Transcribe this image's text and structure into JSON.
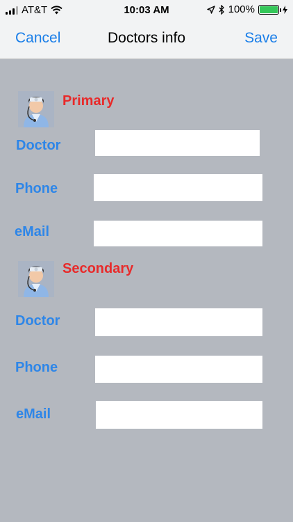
{
  "status_bar": {
    "carrier": "AT&T",
    "time": "10:03 AM",
    "battery": "100%",
    "icons": [
      "signal-icon",
      "wifi-icon",
      "location-arrow-icon",
      "bluetooth-icon",
      "battery-icon",
      "charging-bolt-icon"
    ],
    "battery_color": "#34c759"
  },
  "nav": {
    "cancel_label": "Cancel",
    "title": "Doctors info",
    "save_label": "Save",
    "accent_color": "#1a7ee8"
  },
  "sections": [
    {
      "title": "Primary",
      "icon": "doctor-icon",
      "fields": [
        {
          "label": "Doctor",
          "value": ""
        },
        {
          "label": "Phone",
          "value": ""
        },
        {
          "label": "eMail",
          "value": ""
        }
      ]
    },
    {
      "title": "Secondary",
      "icon": "doctor-icon",
      "fields": [
        {
          "label": "Doctor",
          "value": ""
        },
        {
          "label": "Phone",
          "value": ""
        },
        {
          "label": "eMail",
          "value": ""
        }
      ]
    }
  ],
  "colors": {
    "background": "#b4b8bf",
    "section_title": "#e82a2a",
    "field_label": "#2e86e8"
  }
}
